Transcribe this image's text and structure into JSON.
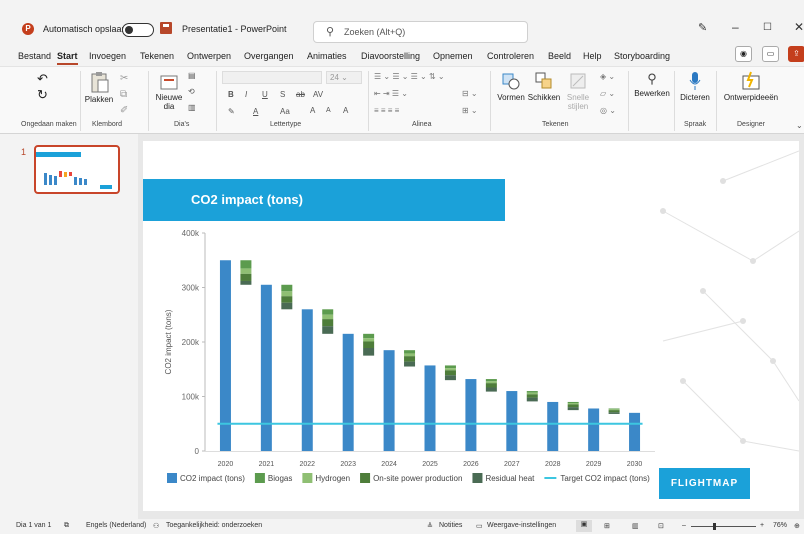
{
  "titlebar": {
    "autosave_label": "Automatisch opslaan",
    "doc_title": "Presentatie1 - PowerPoint",
    "search_placeholder": "Zoeken (Alt+Q)",
    "app_logo": "P"
  },
  "menu": {
    "items": [
      "Bestand",
      "Start",
      "Invoegen",
      "Tekenen",
      "Ontwerpen",
      "Overgangen",
      "Animaties",
      "Diavoorstelling",
      "Opnemen",
      "Controleren",
      "Beeld",
      "Help",
      "Storyboarding"
    ],
    "active": "Start"
  },
  "ribbon": {
    "groups": {
      "undo": "Ongedaan maken",
      "clipboard": "Klembord",
      "slides": "Dia's",
      "font": "Lettertype",
      "paragraph": "Alinea",
      "drawing": "Tekenen",
      "voice": "Spraak",
      "designer": "Designer"
    },
    "buttons": {
      "paste": "Plakken",
      "new_slide": "Nieuwe dia",
      "shapes": "Vormen",
      "arrange": "Schikken",
      "quick_styles": "Snelle stijlen",
      "edit": "Bewerken",
      "dictate": "Dicteren",
      "designer_ideas": "Ontwerpideeën"
    },
    "font_size": "24",
    "font_buttons": [
      "B",
      "I",
      "U",
      "S",
      "ab",
      "AV",
      "A",
      "Aa",
      "A",
      "A",
      "A"
    ]
  },
  "thumbnail": {
    "number": "1"
  },
  "slide": {
    "title": "CO2 impact (tons)",
    "brand": "FLIGHTMAP"
  },
  "chart_data": {
    "type": "bar",
    "title": "",
    "ylabel": "CO2 impact (tons)",
    "ylim": [
      0,
      400000
    ],
    "yticks": [
      0,
      100000,
      200000,
      300000,
      400000
    ],
    "ytick_labels": [
      "0",
      "100k",
      "200k",
      "300k",
      "400k"
    ],
    "categories": [
      "2020",
      "2021",
      "2022",
      "2023",
      "2024",
      "2025",
      "2026",
      "2027",
      "2028",
      "2029",
      "2030"
    ],
    "series": [
      {
        "name": "CO2 impact (tons)",
        "color": "#3b88c8",
        "values": [
          350000,
          305000,
          260000,
          215000,
          185000,
          157000,
          132000,
          110000,
          90000,
          78000,
          70000
        ]
      },
      {
        "name": "Biogas",
        "color": "#5c9b4e",
        "start": [
          350000,
          305000,
          260000,
          215000,
          185000,
          157000,
          132000,
          110000,
          90000,
          78000
        ],
        "values": [
          -15000,
          -12000,
          -10000,
          -8000,
          -6000,
          -5000,
          -4000,
          -3000,
          -2000,
          -1500
        ]
      },
      {
        "name": "Hydrogen",
        "color": "#8fbf73",
        "values": [
          -10000,
          -9000,
          -8000,
          -6000,
          -5000,
          -4000,
          -3500,
          -3000,
          -2500,
          -1500
        ]
      },
      {
        "name": "On-site power production",
        "color": "#4e7d3a",
        "values": [
          -13000,
          -12000,
          -13000,
          -12000,
          -10000,
          -9000,
          -8000,
          -6000,
          -5000,
          -4000
        ]
      },
      {
        "name": "Residual heat",
        "color": "#4a6b54",
        "values": [
          -7000,
          -12000,
          -14000,
          -14000,
          -9000,
          -9000,
          -7500,
          -7000,
          -5500,
          -3000
        ]
      },
      {
        "name": "Target CO2 impact (tons)",
        "color": "#3cc6e0",
        "type": "line",
        "value": 50000
      }
    ]
  },
  "statusbar": {
    "slide_of": "Dia 1 van 1",
    "language": "Engels (Nederland)",
    "accessibility": "Toegankelijkheid: onderzoeken",
    "notes": "Notities",
    "display_settings": "Weergave-instellingen",
    "zoom": "76%"
  }
}
